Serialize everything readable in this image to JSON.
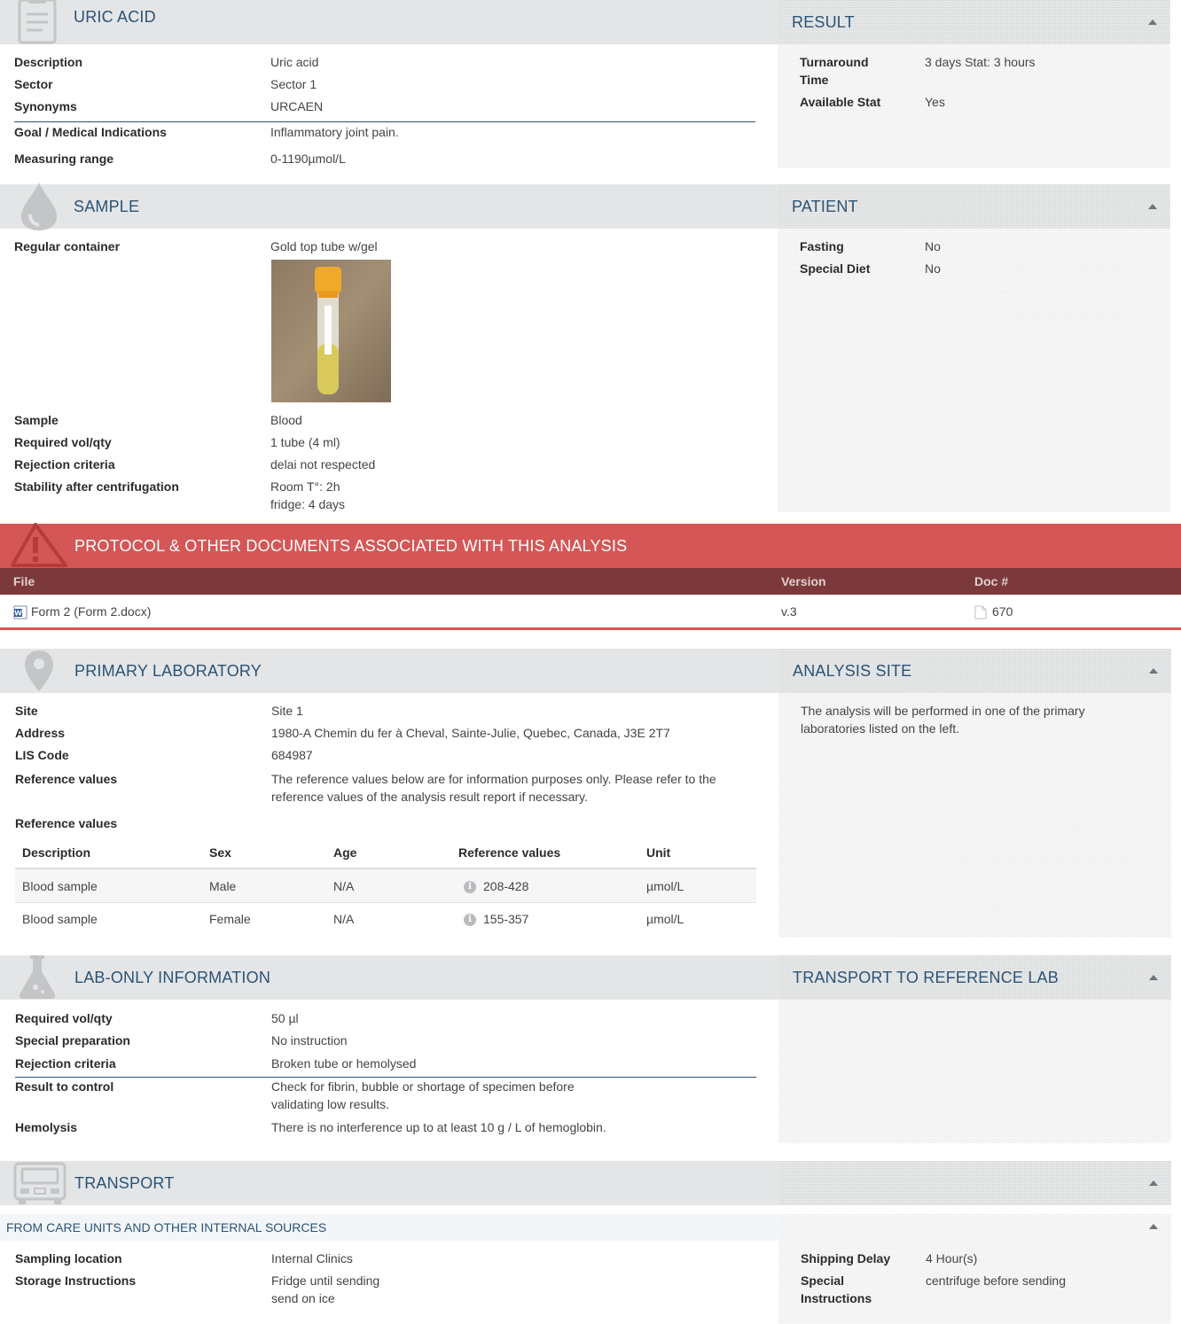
{
  "uric": {
    "title": "URIC ACID",
    "rows": [
      {
        "label": "Description",
        "value": "Uric acid"
      },
      {
        "label": "Sector",
        "value": "Sector 1"
      },
      {
        "label": "Synonyms",
        "value": "URCAEN"
      },
      {
        "label": "Goal / Medical Indications",
        "value": "Inflammatory joint pain."
      },
      {
        "label": "Measuring range",
        "value": "0-1190µmol/L"
      }
    ]
  },
  "result": {
    "title": "RESULT",
    "rows": [
      {
        "label": "Turnaround Time",
        "value": "3 days Stat: 3 hours"
      },
      {
        "label": "Available Stat",
        "value": "Yes"
      }
    ]
  },
  "sample": {
    "title": "SAMPLE",
    "container_label": "Regular container",
    "container_value": "Gold top tube w/gel",
    "rows": [
      {
        "label": "Sample",
        "value": "Blood"
      },
      {
        "label": "Required vol/qty",
        "value": "1 tube (4 ml)"
      },
      {
        "label": "Rejection criteria",
        "value": "delai not respected"
      },
      {
        "label": "Stability after centrifugation",
        "value": "Room T°: 2h",
        "value2": "fridge: 4 days"
      }
    ]
  },
  "patient": {
    "title": "PATIENT",
    "rows": [
      {
        "label": "Fasting",
        "value": "No"
      },
      {
        "label": "Special Diet",
        "value": "No"
      }
    ]
  },
  "documents": {
    "title": "PROTOCOL & OTHER DOCUMENTS ASSOCIATED WITH THIS ANALYSIS",
    "col_file": "File",
    "col_version": "Version",
    "col_doc": "Doc #",
    "rows": [
      {
        "file": "Form 2 (Form 2.docx)",
        "version": "v.3",
        "doc": "670"
      }
    ]
  },
  "primary_lab": {
    "title": "PRIMARY LABORATORY",
    "rows": [
      {
        "label": "Site",
        "value": "Site 1"
      },
      {
        "label": "Address",
        "value": "1980-A Chemin du fer à Cheval, Sainte-Julie, Quebec, Canada, J3E 2T7"
      },
      {
        "label": "LIS Code",
        "value": "684987"
      }
    ],
    "ref_label": "Reference values",
    "ref_note_1": "The reference values below are for information purposes only. Please refer to the",
    "ref_note_2": "reference values of the analysis result report if necessary.",
    "ref_table_title": "Reference values",
    "ref_headers": [
      "Description",
      "Sex",
      "Age",
      "Reference values",
      "Unit"
    ],
    "ref_rows": [
      {
        "description": "Blood sample",
        "sex": "Male",
        "age": "N/A",
        "ref": "208-428",
        "unit": "µmol/L"
      },
      {
        "description": "Blood sample",
        "sex": "Female",
        "age": "N/A",
        "ref": "155-357",
        "unit": "µmol/L"
      }
    ]
  },
  "analysis_site": {
    "title": "ANALYSIS SITE",
    "text_1": "The analysis will be performed in one of the primary",
    "text_2": "laboratories listed on the left."
  },
  "lab_only": {
    "title": "LAB-ONLY INFORMATION",
    "rows": [
      {
        "label": "Required vol/qty",
        "value": "50 µl"
      },
      {
        "label": "Special preparation",
        "value": "No instruction"
      },
      {
        "label": "Rejection criteria",
        "value": "Broken tube or hemolysed"
      },
      {
        "label": "Result to control",
        "value": "Check for fibrin, bubble or shortage of specimen before",
        "value2": "validating low results."
      },
      {
        "label": "Hemolysis",
        "value": "There is no interference up to at least 10 g / L of hemoglobin."
      }
    ]
  },
  "transport_ref": {
    "title": "TRANSPORT TO REFERENCE LAB"
  },
  "transport": {
    "title": "TRANSPORT",
    "subtitle": "FROM CARE UNITS AND OTHER INTERNAL SOURCES",
    "rows": [
      {
        "label": "Sampling location",
        "value": "Internal Clinics"
      },
      {
        "label": "Storage Instructions",
        "value": "Fridge until sending",
        "value2": "send on ice"
      }
    ],
    "side_rows": [
      {
        "label": "Shipping Delay",
        "value": "4 Hour(s)"
      },
      {
        "label_1": "Special",
        "label_2": "Instructions",
        "value": "centrifuge before sending"
      }
    ]
  },
  "colors": {
    "header_bg": "#e4e5e6",
    "title_blue": "#2a5377",
    "danger": "#d45656",
    "danger_dark": "#7c393b"
  }
}
